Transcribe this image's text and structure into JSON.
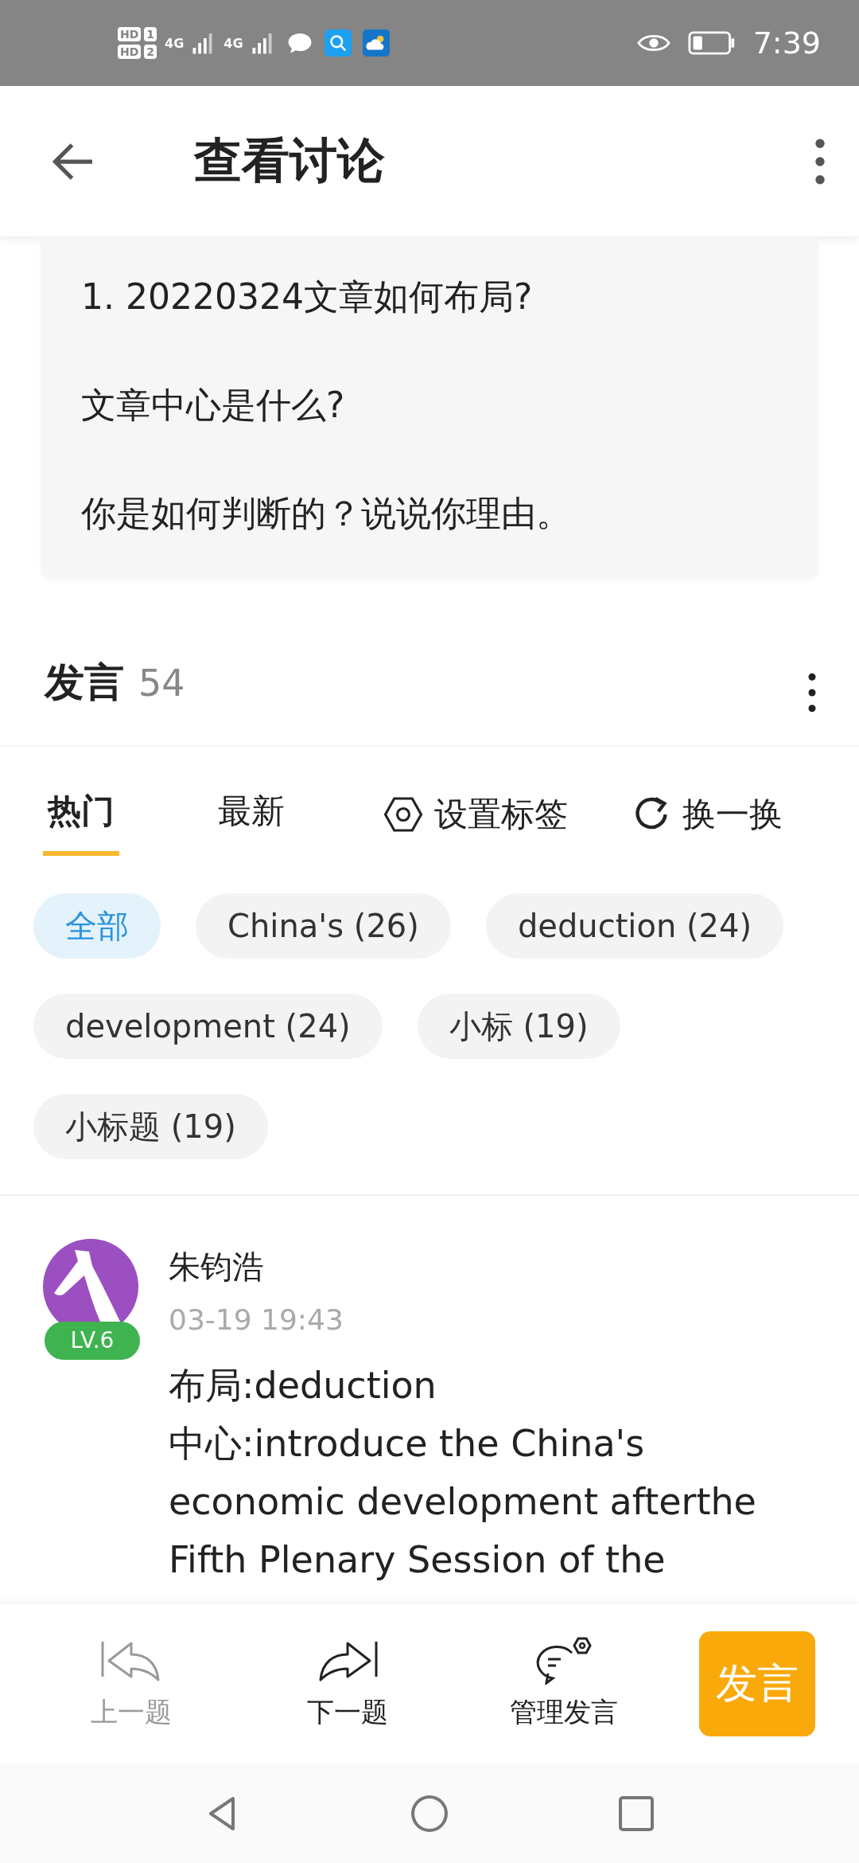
{
  "status_bar": {
    "sim_labels": [
      "HD",
      "HD"
    ],
    "sim_numbers": [
      "1",
      "2"
    ],
    "network": [
      "4G",
      "4G"
    ],
    "time": "7:39"
  },
  "header": {
    "title": "查看讨论"
  },
  "question": {
    "lines": [
      "1. 20220324文章如何布局?",
      "文章中心是什么?",
      "你是如何判断的？说说你理由。"
    ]
  },
  "posts_header": {
    "title": "发言",
    "count": "54"
  },
  "tabs": [
    {
      "label": "热门",
      "selected": true,
      "kind": "tab"
    },
    {
      "label": "最新",
      "selected": false,
      "kind": "tab"
    },
    {
      "label": "设置标签",
      "selected": false,
      "kind": "settings"
    },
    {
      "label": "换一换",
      "selected": false,
      "kind": "refresh"
    }
  ],
  "tags": [
    {
      "label": "全部",
      "selected": true
    },
    {
      "label": "China's (26)",
      "selected": false
    },
    {
      "label": "deduction (24)",
      "selected": false
    },
    {
      "label": "development (24)",
      "selected": false
    },
    {
      "label": "小标 (19)",
      "selected": false
    },
    {
      "label": "小标题 (19)",
      "selected": false
    }
  ],
  "post": {
    "author": "朱钧浩",
    "level": "LV.6",
    "time": "03-19 19:43",
    "lines": [
      "布局:deduction",
      "中心:introduce the China's economic development afterthe Fifth Plenary Session of the"
    ]
  },
  "bottom_bar": {
    "items": [
      {
        "label": "上一题",
        "kind": "prev",
        "disabled": true
      },
      {
        "label": "下一题",
        "kind": "next",
        "disabled": false
      },
      {
        "label": "管理发言",
        "kind": "manage",
        "disabled": false
      }
    ],
    "post_button": "发言"
  }
}
